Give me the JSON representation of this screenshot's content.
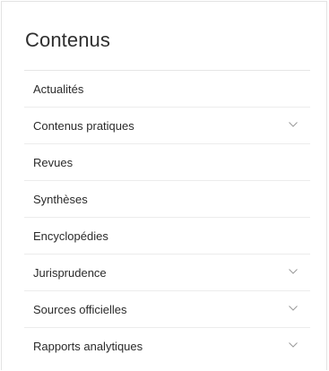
{
  "panel": {
    "title": "Contenus"
  },
  "menu": {
    "items": [
      {
        "label": "Actualités",
        "expandable": false,
        "icon": "chevron-down-icon"
      },
      {
        "label": "Contenus pratiques",
        "expandable": true,
        "icon": "chevron-down-icon"
      },
      {
        "label": "Revues",
        "expandable": false,
        "icon": "chevron-down-icon"
      },
      {
        "label": "Synthèses",
        "expandable": false,
        "icon": "chevron-down-icon"
      },
      {
        "label": "Encyclopédies",
        "expandable": false,
        "icon": "chevron-down-icon"
      },
      {
        "label": "Jurisprudence",
        "expandable": true,
        "icon": "chevron-down-icon"
      },
      {
        "label": "Sources officielles",
        "expandable": true,
        "icon": "chevron-down-icon"
      },
      {
        "label": "Rapports analytiques",
        "expandable": true,
        "icon": "chevron-down-icon"
      }
    ]
  },
  "colors": {
    "text": "#2b2b2b",
    "divider": "#ececec",
    "chevron": "#9a9a9a",
    "border": "#e3e3e3"
  }
}
